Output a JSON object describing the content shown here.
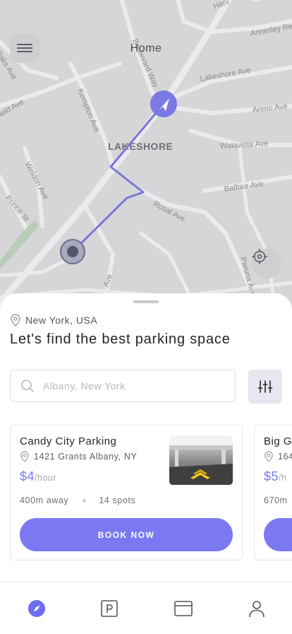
{
  "header": {
    "title": "Home"
  },
  "map": {
    "area_label": "LAKESHORE",
    "street_labels": [
      "Harv",
      "Annerley Re",
      "Lakeshore Ave",
      "Arimo Ave",
      "Walavista Ave",
      "Balfour Ave",
      "Rosal Ave",
      "Paruna Ave",
      "Boulevard Way",
      "Kempton Ave",
      "Weldon Ave",
      "Prince St",
      "Field Ave",
      "Oaks Ave",
      "Ave"
    ],
    "route_color": "#7877d9"
  },
  "location": {
    "label": "New York, USA"
  },
  "headline": "Let's find the best parking space",
  "search": {
    "placeholder": "Albany, New York",
    "value": ""
  },
  "cards": [
    {
      "name": "Candy City Parking",
      "address": "1421 Grants Albany, NY",
      "price": "$4",
      "unit": "/hour",
      "distance": "400m away",
      "spots": "14 spots",
      "button": "BOOK NOW"
    },
    {
      "name": "Big G",
      "address": "164",
      "price": "$5",
      "unit": "/h",
      "distance": "670m",
      "spots": "",
      "button": ""
    }
  ],
  "tabs": [
    {
      "name": "explore",
      "icon": "compass-icon",
      "active": true
    },
    {
      "name": "parking",
      "icon": "parking-icon",
      "active": false
    },
    {
      "name": "payment",
      "icon": "card-icon",
      "active": false
    },
    {
      "name": "profile",
      "icon": "user-icon",
      "active": false
    }
  ],
  "colors": {
    "accent": "#7b79f2",
    "map_bg": "#d6d6d8",
    "road": "#ebebed",
    "active_tab": "#6f6df0"
  }
}
